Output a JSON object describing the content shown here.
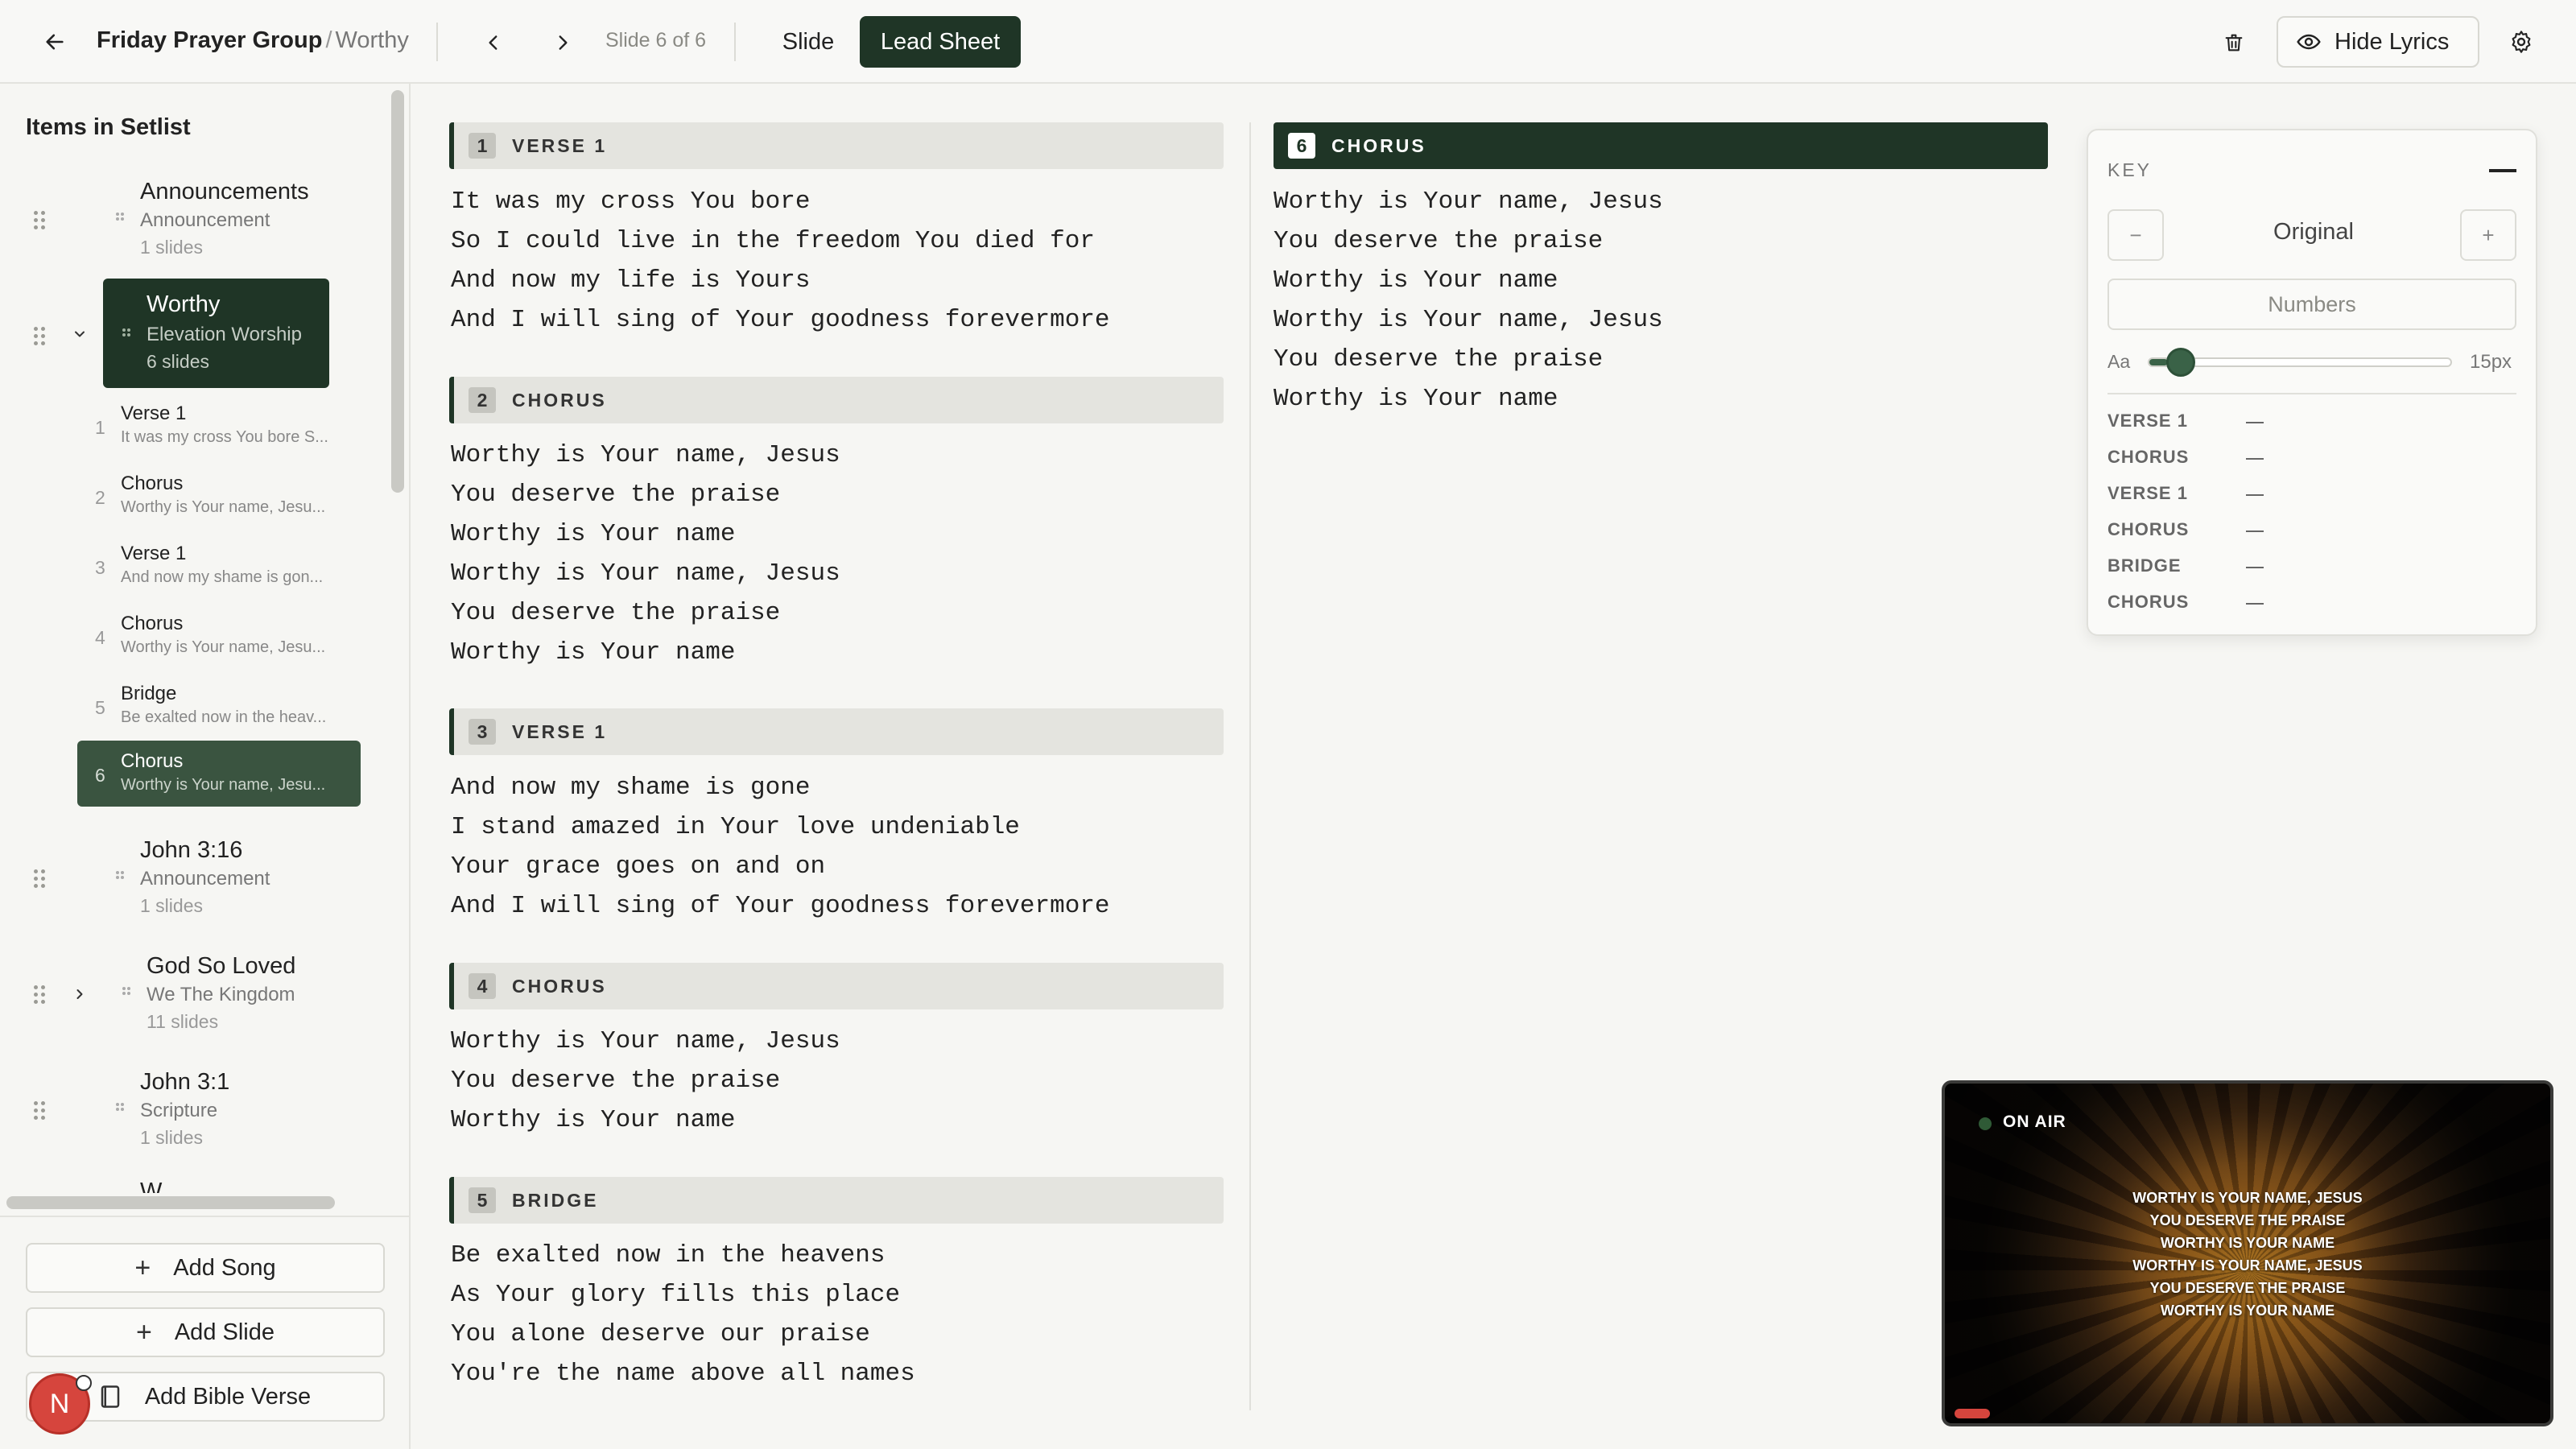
{
  "header": {
    "group": "Friday Prayer Group",
    "separator": "/",
    "song": "Worthy",
    "slide_counter": "Slide 6 of 6",
    "tab_slide": "Slide",
    "tab_lead_sheet": "Lead Sheet",
    "hide_lyrics": "Hide Lyrics"
  },
  "sidebar": {
    "title": "Items in Setlist",
    "items": [
      {
        "title": "Announcements",
        "subtitle": "Announcement",
        "count": "1 slides"
      },
      {
        "title": "Worthy",
        "subtitle": "Elevation Worship",
        "count": "6 slides"
      },
      {
        "title": "John 3:16",
        "subtitle": "Announcement",
        "count": "1 slides"
      },
      {
        "title": "God So Loved",
        "subtitle": "We The Kingdom",
        "count": "11 slides"
      },
      {
        "title": "John 3:1",
        "subtitle": "Scripture",
        "count": "1 slides"
      },
      {
        "title": "W..."
      }
    ],
    "slides": [
      {
        "num": "1",
        "label": "Verse 1",
        "preview": "It was my cross You bore S..."
      },
      {
        "num": "2",
        "label": "Chorus",
        "preview": "Worthy is Your name, Jesu..."
      },
      {
        "num": "3",
        "label": "Verse 1",
        "preview": "And now my shame is gon..."
      },
      {
        "num": "4",
        "label": "Chorus",
        "preview": "Worthy is Your name, Jesu..."
      },
      {
        "num": "5",
        "label": "Bridge",
        "preview": "Be exalted now in the heav..."
      },
      {
        "num": "6",
        "label": "Chorus",
        "preview": "Worthy is Your name, Jesu..."
      }
    ],
    "add_song": "Add Song",
    "add_slide": "Add Slide",
    "add_bible_verse": "Add Bible Verse",
    "avatar_initial": "N",
    "plus": "+"
  },
  "sections": [
    {
      "num": "1",
      "title": "VERSE 1",
      "lines": [
        "It was my cross You bore",
        "So I could live in the freedom You died for",
        "And now my life is Yours",
        "And I will sing of Your goodness forevermore"
      ]
    },
    {
      "num": "2",
      "title": "CHORUS",
      "lines": [
        "Worthy is Your name, Jesus",
        "You deserve the praise",
        "Worthy is Your name",
        "Worthy is Your name, Jesus",
        "You deserve the praise",
        "Worthy is Your name"
      ]
    },
    {
      "num": "3",
      "title": "VERSE 1",
      "lines": [
        "And now my shame is gone",
        "I stand amazed in Your love undeniable",
        "Your grace goes on and on",
        "And I will sing of Your goodness forevermore"
      ]
    },
    {
      "num": "4",
      "title": "CHORUS",
      "lines": [
        "Worthy is Your name, Jesus",
        "You deserve the praise",
        "Worthy is Your name"
      ]
    },
    {
      "num": "5",
      "title": "BRIDGE",
      "lines": [
        "Be exalted now in the heavens",
        "As Your glory fills this place",
        "You alone deserve our praise",
        "You're the name above all names"
      ]
    },
    {
      "num": "6",
      "title": "CHORUS",
      "lines": [
        "Worthy is Your name, Jesus",
        "You deserve the praise",
        "Worthy is Your name",
        "Worthy is Your name, Jesus",
        "You deserve the praise",
        "Worthy is Your name"
      ]
    }
  ],
  "key_panel": {
    "label": "KEY",
    "minus": "−",
    "plus": "+",
    "original": "Original",
    "numbers": "Numbers",
    "aa": "Aa",
    "font_size": "15px",
    "font_slider_fraction": 0.06,
    "rows": [
      {
        "label": "VERSE 1"
      },
      {
        "label": "CHORUS"
      },
      {
        "label": "VERSE 1"
      },
      {
        "label": "CHORUS"
      },
      {
        "label": "BRIDGE"
      },
      {
        "label": "CHORUS"
      }
    ]
  },
  "on_air": {
    "label": "ON AIR",
    "lines": [
      "WORTHY IS YOUR NAME, JESUS",
      "YOU DESERVE THE PRAISE",
      "WORTHY IS YOUR NAME",
      "WORTHY IS YOUR NAME, JESUS",
      "YOU DESERVE THE PRAISE",
      "WORTHY IS YOUR NAME"
    ]
  },
  "colors": {
    "accent_dark_green": "#1f3526",
    "active_row_green": "#3a5440",
    "slider_green": "#3a6247",
    "avatar_red": "#d6453d"
  },
  "icons": [
    "back-arrow-icon",
    "chevron-left-icon",
    "chevron-right-icon",
    "trash-icon",
    "eye-icon",
    "gear-icon",
    "drag-handle-icon",
    "chevron-down-icon",
    "chevron-right-icon",
    "plus-icon",
    "bible-icon"
  ]
}
